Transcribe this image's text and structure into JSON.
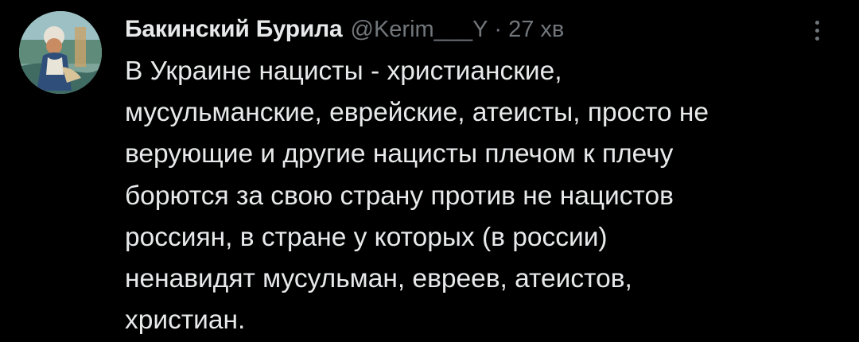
{
  "tweet": {
    "author": {
      "display_name": "Бакинский Бурила",
      "handle": "@Kerim___Y",
      "avatar_icon": "avatar-portrait-painting"
    },
    "separator": "·",
    "time": "27 хв",
    "text": "В Украине нацисты - христианские,\nмусульманские, еврейские, атеисты, просто не\nверующие и другие нацисты плечом к плечу\nборются за свою страну против не нацистов\nроссиян, в стране у которых (в россии)\nненавидят мусульман, евреев, атеистов,\nхристиан.",
    "more_icon": "more-vertical-icon"
  },
  "colors": {
    "background": "#000000",
    "primary_text": "#e7e9ea",
    "secondary_text": "#71767b"
  }
}
